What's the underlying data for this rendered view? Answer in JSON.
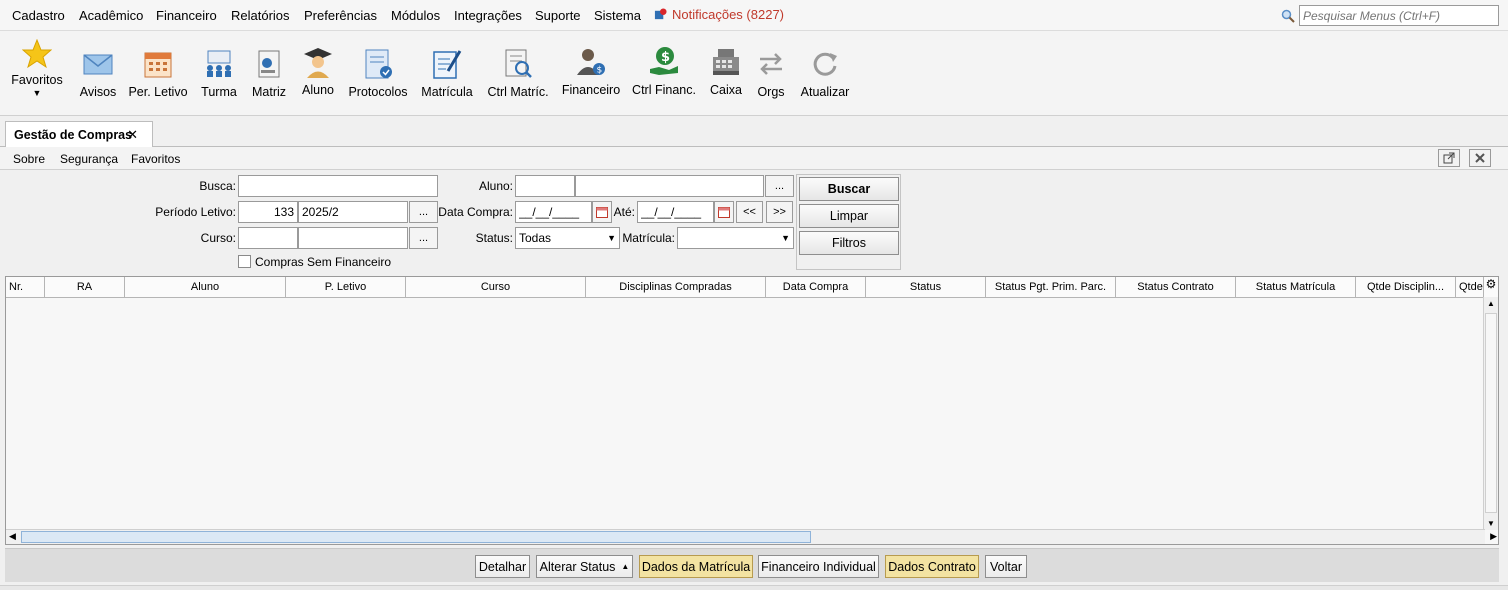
{
  "menu": {
    "items": [
      "Cadastro",
      "Acadêmico",
      "Financeiro",
      "Relatórios",
      "Preferências",
      "Módulos",
      "Integrações",
      "Suporte",
      "Sistema"
    ],
    "notifications": "Notificações (8227)",
    "search_placeholder": "Pesquisar Menus (Ctrl+F)"
  },
  "toolbar": {
    "favoritos": "Favoritos",
    "avisos": "Avisos",
    "per_letivo": "Per. Letivo",
    "turma": "Turma",
    "matriz": "Matriz",
    "aluno": "Aluno",
    "protocolos": "Protocolos",
    "matricula": "Matrícula",
    "ctrl_matric": "Ctrl Matríc.",
    "financeiro": "Financeiro",
    "ctrl_financ": "Ctrl Financ.",
    "caixa": "Caixa",
    "orgs": "Orgs",
    "atualizar": "Atualizar"
  },
  "tab": {
    "title": "Gestão de Compras",
    "close": "✕"
  },
  "submenu": {
    "sobre": "Sobre",
    "seguranca": "Segurança",
    "favoritos": "Favoritos"
  },
  "filters": {
    "busca_label": "Busca:",
    "busca_value": "",
    "periodo_label": "Período Letivo:",
    "periodo_code": "133",
    "periodo_value": "2025/2",
    "curso_label": "Curso:",
    "aluno_label": "Aluno:",
    "data_compra_label": "Data Compra:",
    "data_compra_value": "__/__/____",
    "ate_label": "Até:",
    "ate_value": "__/__/____",
    "status_label": "Status:",
    "status_value": "Todas",
    "matricula_label": "Matrícula:",
    "matricula_value": "",
    "compras_sem_financeiro": "Compras Sem Financeiro",
    "dots": "...",
    "prev": "<<",
    "next": ">>"
  },
  "actions": {
    "buscar": "Buscar",
    "limpar": "Limpar",
    "filtros": "Filtros"
  },
  "grid": {
    "columns": [
      "Nr.",
      "RA",
      "Aluno",
      "P. Letivo",
      "Curso",
      "Disciplinas Compradas",
      "Data Compra",
      "Status",
      "Status Pgt. Prim. Parc.",
      "Status Contrato",
      "Status Matrícula",
      "Qtde Disciplin...",
      "Qtde"
    ]
  },
  "bottom": {
    "detalhar": "Detalhar",
    "alterar_status": "Alterar Status",
    "dados_matricula": "Dados da Matrícula",
    "financeiro_individual": "Financeiro Individual",
    "dados_contrato": "Dados Contrato",
    "voltar": "Voltar"
  },
  "colors": {
    "accent_blue": "#2f6fb3",
    "notif_red": "#c0392b",
    "highlight": "#f3e3a2"
  }
}
